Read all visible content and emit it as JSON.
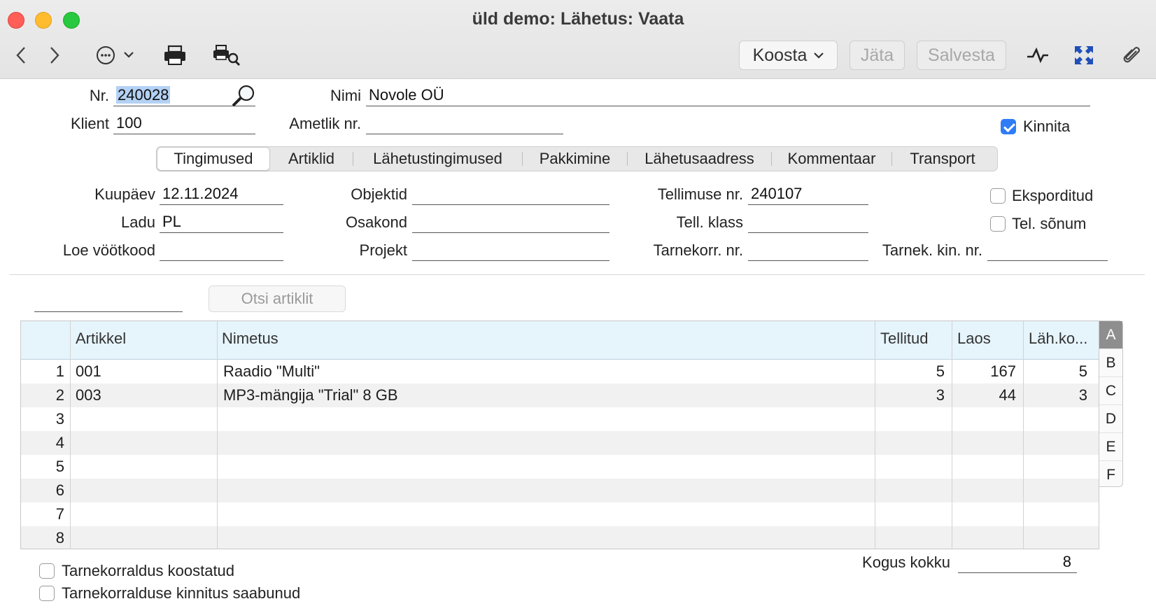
{
  "window": {
    "title": "üld demo: Lähetus: Vaata"
  },
  "toolbar": {
    "koosta_label": "Koosta",
    "jata_label": "Jäta",
    "salvesta_label": "Salvesta"
  },
  "header": {
    "nr_label": "Nr.",
    "nr_value": "240028",
    "nimi_label": "Nimi",
    "nimi_value": "Novole OÜ",
    "klient_label": "Klient",
    "klient_value": "100",
    "ametlik_label": "Ametlik nr.",
    "ametlik_value": "",
    "kinnita_label": "Kinnita",
    "kinnita_checked": true
  },
  "tabs": [
    {
      "label": "Tingimused",
      "active": true
    },
    {
      "label": "Artiklid",
      "active": false
    },
    {
      "label": "Lähetustingimused",
      "active": false
    },
    {
      "label": "Pakkimine",
      "active": false
    },
    {
      "label": "Lähetusaadress",
      "active": false
    },
    {
      "label": "Kommentaar",
      "active": false
    },
    {
      "label": "Transport",
      "active": false
    }
  ],
  "terms": {
    "kuupaev_label": "Kuupäev",
    "kuupaev_value": "12.11.2024",
    "ladu_label": "Ladu",
    "ladu_value": "PL",
    "loe_label": "Loe vöötkood",
    "loe_value": "",
    "objektid_label": "Objektid",
    "objektid_value": "",
    "osakond_label": "Osakond",
    "osakond_value": "",
    "projekt_label": "Projekt",
    "projekt_value": "",
    "tellimuse_label": "Tellimuse nr.",
    "tellimuse_value": "240107",
    "tellklass_label": "Tell. klass",
    "tellklass_value": "",
    "tarnekorr_label": "Tarnekorr. nr.",
    "tarnekorr_value": "",
    "tarnekkin_label": "Tarnek. kin. nr.",
    "tarnekkin_value": "",
    "eksporditud_label": "Eksporditud",
    "telsonum_label": "Tel. sõnum"
  },
  "search": {
    "button_label": "Otsi artiklit",
    "value": ""
  },
  "grid": {
    "columns": [
      "",
      "Artikkel",
      "Nimetus",
      "Tellitud",
      "Laos",
      "Läh.ko..."
    ],
    "rows": [
      {
        "n": "1",
        "artikkel": "001",
        "nimetus": "Raadio \"Multi\"",
        "tellitud": "5",
        "laos": "167",
        "lahko": "5"
      },
      {
        "n": "2",
        "artikkel": "003",
        "nimetus": "MP3-mängija \"Trial\" 8 GB",
        "tellitud": "3",
        "laos": "44",
        "lahko": "3"
      },
      {
        "n": "3",
        "artikkel": "",
        "nimetus": "",
        "tellitud": "",
        "laos": "",
        "lahko": ""
      },
      {
        "n": "4",
        "artikkel": "",
        "nimetus": "",
        "tellitud": "",
        "laos": "",
        "lahko": ""
      },
      {
        "n": "5",
        "artikkel": "",
        "nimetus": "",
        "tellitud": "",
        "laos": "",
        "lahko": ""
      },
      {
        "n": "6",
        "artikkel": "",
        "nimetus": "",
        "tellitud": "",
        "laos": "",
        "lahko": ""
      },
      {
        "n": "7",
        "artikkel": "",
        "nimetus": "",
        "tellitud": "",
        "laos": "",
        "lahko": ""
      },
      {
        "n": "8",
        "artikkel": "",
        "nimetus": "",
        "tellitud": "",
        "laos": "",
        "lahko": ""
      }
    ],
    "side_tabs": [
      "A",
      "B",
      "C",
      "D",
      "E",
      "F"
    ]
  },
  "footer": {
    "tarnekorraldus_label": "Tarnekorraldus koostatud",
    "tarnekinnitus_label": "Tarnekorralduse kinnitus saabunud",
    "kogus_label": "Kogus kokku",
    "kogus_value": "8"
  }
}
